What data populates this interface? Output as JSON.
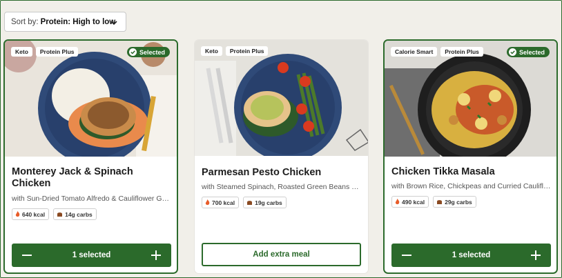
{
  "sort": {
    "label": "Sort by:",
    "value": "Protein: High to low",
    "icon": "chevron-down-icon"
  },
  "colors": {
    "accent": "#2b6a2b",
    "background": "#f1efe9"
  },
  "cards": [
    {
      "tags": [
        "Keto",
        "Protein Plus"
      ],
      "selected_badge": "Selected",
      "title": "Monterey Jack & Spinach Chicken",
      "subtitle": "with Sun-Dried Tomato Alfredo & Cauliflower G…",
      "kcal": "640 kcal",
      "carbs": "14g carbs",
      "count_label": "1 selected"
    },
    {
      "tags": [
        "Keto",
        "Protein Plus"
      ],
      "title": "Parmesan Pesto Chicken",
      "subtitle": "with Steamed Spinach, Roasted Green Beans &…",
      "kcal": "700 kcal",
      "carbs": "19g carbs",
      "add_label": "Add extra meal"
    },
    {
      "tags": [
        "Calorie Smart",
        "Protein Plus"
      ],
      "selected_badge": "Selected",
      "title": "Chicken Tikka Masala",
      "subtitle": "with Brown Rice, Chickpeas and Curried Caulifl…",
      "kcal": "490 kcal",
      "carbs": "29g carbs",
      "count_label": "1 selected"
    }
  ]
}
